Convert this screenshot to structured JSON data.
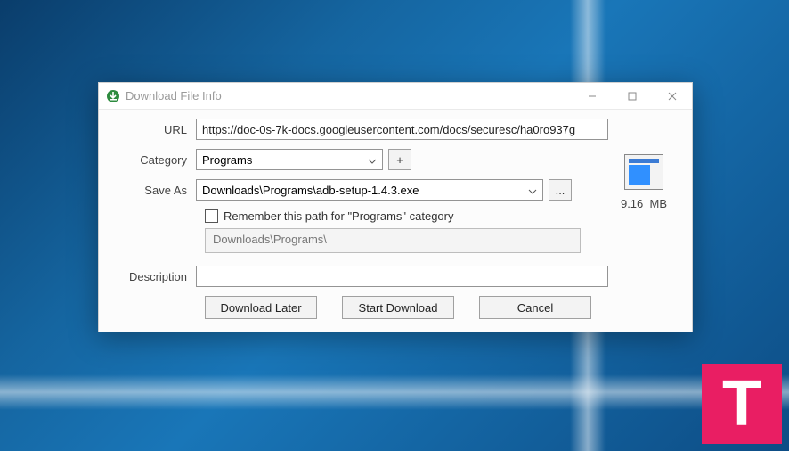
{
  "window": {
    "title": "Download File Info"
  },
  "form": {
    "url_label": "URL",
    "url_value": "https://doc-0s-7k-docs.googleusercontent.com/docs/securesc/ha0ro937g",
    "category_label": "Category",
    "category_value": "Programs",
    "add_category_label": "+",
    "saveas_label": "Save As",
    "saveas_value": "Downloads\\Programs\\adb-setup-1.4.3.exe",
    "browse_label": "...",
    "remember_label": "Remember this path for \"Programs\" category",
    "remember_path_value": "Downloads\\Programs\\",
    "description_label": "Description",
    "description_value": ""
  },
  "file": {
    "size": "9.16",
    "size_unit": "MB"
  },
  "actions": {
    "later": "Download Later",
    "start": "Start Download",
    "cancel": "Cancel"
  },
  "watermark": "T"
}
